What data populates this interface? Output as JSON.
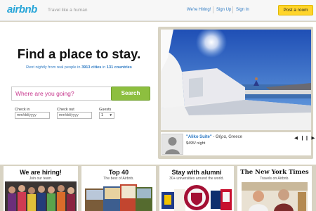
{
  "header": {
    "logo": "airbnb",
    "tagline": "Travel like a human",
    "nav": [
      "We're Hiring!",
      "Sign Up",
      "Sign In"
    ],
    "post_button": "Post a room"
  },
  "hero": {
    "title": "Find a place to stay.",
    "subtitle_prefix": "Rent nightly from real people in ",
    "cities": "3913 cities",
    "subtitle_mid": " in ",
    "countries": "131 countries"
  },
  "search": {
    "placeholder": "Where are you going?",
    "button": "Search",
    "checkin_label": "Check in",
    "checkin_placeholder": "mm/dd/yyyy",
    "checkout_label": "Check out",
    "checkout_placeholder": "mm/dd/yyyy",
    "guests_label": "Guests",
    "guests_value": "1"
  },
  "featured": {
    "title": "\"Aliko Suite\"",
    "place": " - Θήρα, Greece",
    "price": "$495/ night",
    "controls": "◀ ❙❙ ▶"
  },
  "cards": [
    {
      "title": "We are hiring!",
      "sub": "Join our team."
    },
    {
      "title": "Top 40",
      "sub": "The best of Airbnb."
    },
    {
      "title": "Stay with alumni",
      "sub": "30+ universities around the world."
    },
    {
      "title": "The New York Times",
      "sub": "Travels on Airbnb."
    }
  ],
  "colors": {
    "brand": "#27a5d8",
    "accent_yellow": "#ffd52b",
    "search_green": "#8dbf3f",
    "link_blue": "#2b78c2",
    "placeholder_magenta": "#c6348b"
  }
}
